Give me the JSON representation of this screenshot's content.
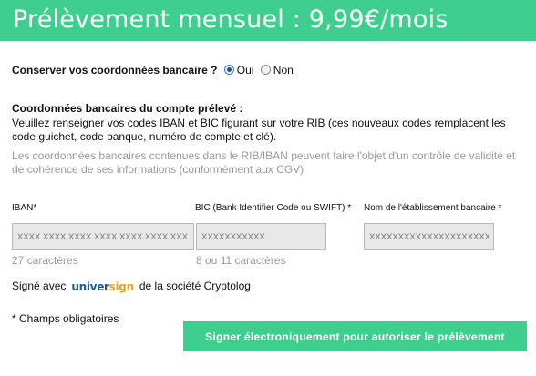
{
  "header": {
    "title": "Prélèvement mensuel : 9,99€/mois"
  },
  "keep_details": {
    "question": "Conserver vos coordonnées bancaire ?",
    "options": [
      {
        "label": "Oui",
        "selected": true
      },
      {
        "label": "Non",
        "selected": false
      }
    ]
  },
  "section": {
    "title": "Coordonnées bancaires du compte prélevé :",
    "instructions": "Veuillez renseigner vos codes IBAN et BIC figurant sur votre RIB (ces nouveaux codes remplacent les code guichet, code banque, numéro de compte et clé).",
    "note": "Les coordonnées bancaires contenues dans le RIB/IBAN peuvent faire l'objet d'un contrôle de validité et de cohérence de ses informations (conformément aux CGV)"
  },
  "fields": {
    "iban": {
      "label": "IBAN*",
      "placeholder": "XXXX XXXX XXXX XXXX XXXX XXXX XXX",
      "hint": "27 caractères"
    },
    "bic": {
      "label": "BIC (Bank Identifier Code ou SWIFT) *",
      "placeholder": "XXXXXXXXXXX",
      "hint": "8 ou 11 caractères"
    },
    "bank_name": {
      "label": "Nom de l'établissement bancaire *",
      "placeholder": "XXXXXXXXXXXXXXXXXXXXX"
    }
  },
  "signature": {
    "prefix": "Signé avec",
    "logo_part1": "univer",
    "logo_part2": "sign",
    "suffix": "de la société Cryptolog"
  },
  "required_note": "* Champs obligatoires",
  "submit_label": "Signer électroniquement pour autoriser le prélèvement",
  "colors": {
    "accent": "#3ecf8e",
    "logo_blue": "#1e56a0",
    "logo_orange": "#e9a21f"
  }
}
